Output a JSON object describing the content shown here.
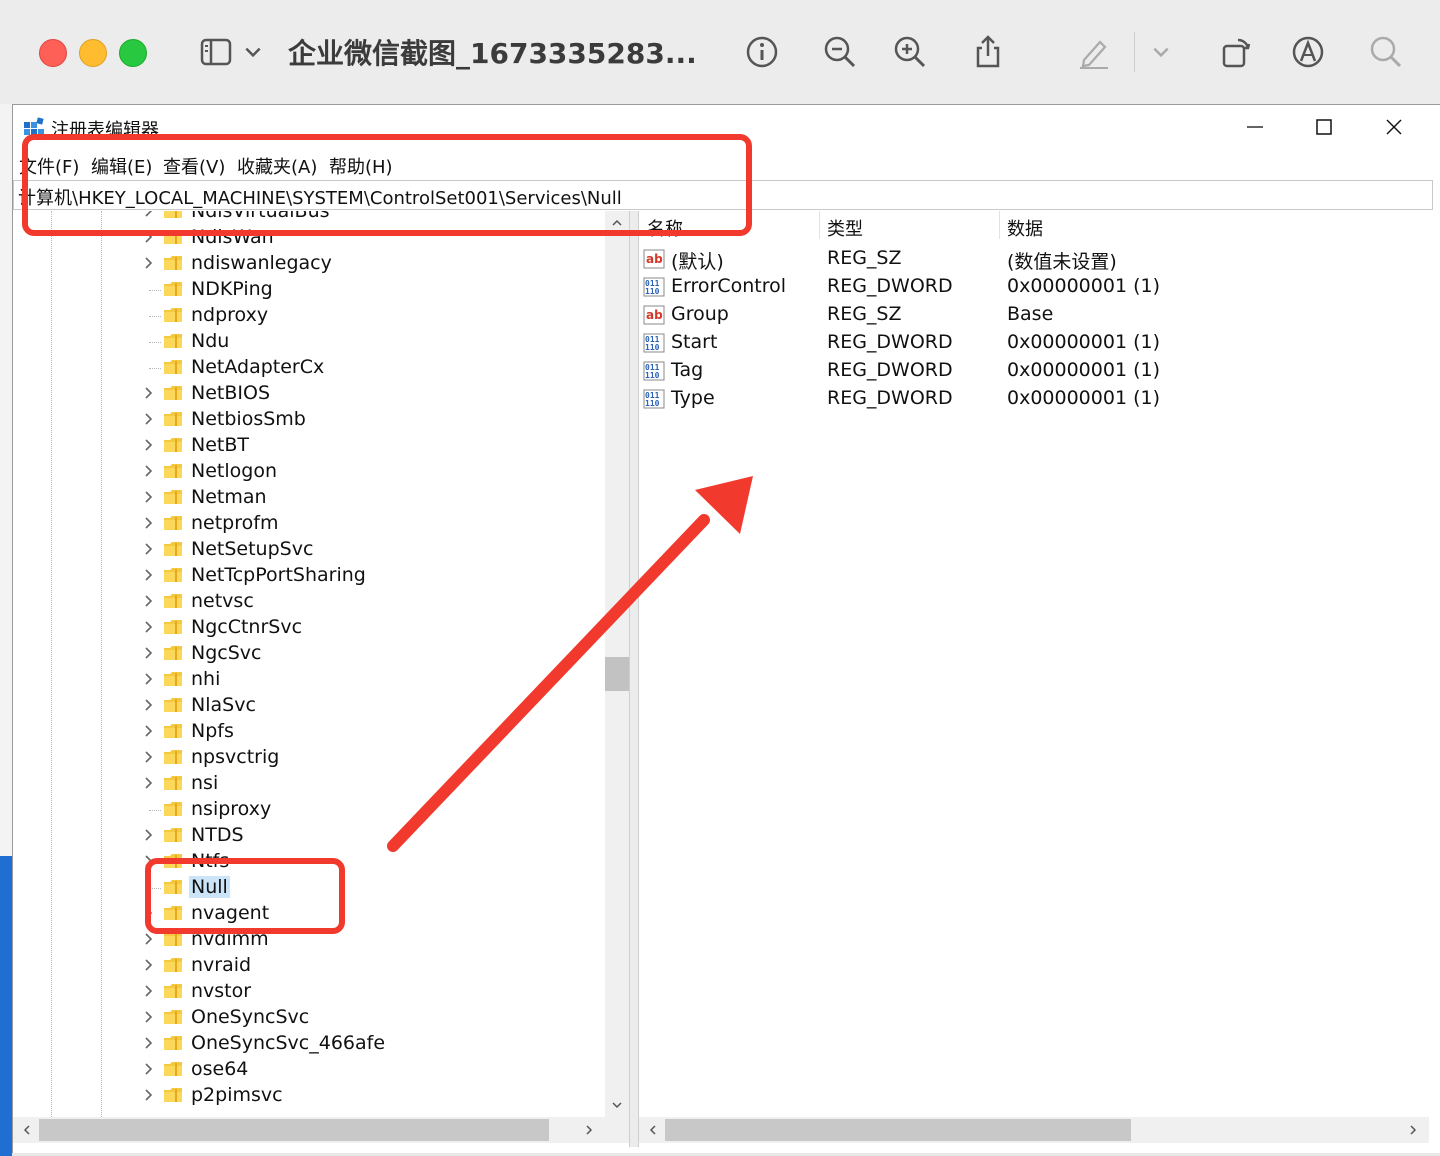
{
  "viewer": {
    "title": "企业微信截图_1673335283...",
    "toolbar_icons": [
      "sidebar-icon",
      "chevron-down-icon",
      "info-icon",
      "zoom-out-icon",
      "zoom-in-icon",
      "share-icon",
      "markup-pen-icon",
      "chevron-down-icon",
      "rotate-icon",
      "markup-icon",
      "search-icon"
    ]
  },
  "window": {
    "title": "注册表编辑器",
    "controls": [
      "minimize",
      "maximize",
      "close"
    ]
  },
  "menu": [
    {
      "label": "文件(F)"
    },
    {
      "label": "编辑(E)"
    },
    {
      "label": "查看(V)"
    },
    {
      "label": "收藏夹(A)"
    },
    {
      "label": "帮助(H)"
    }
  ],
  "address": "计算机\\HKEY_LOCAL_MACHINE\\SYSTEM\\ControlSet001\\Services\\Null",
  "tree": {
    "items": [
      {
        "label": "NdisVirtualBus",
        "expandable": true
      },
      {
        "label": "NdisWan",
        "expandable": true
      },
      {
        "label": "ndiswanlegacy",
        "expandable": true
      },
      {
        "label": "NDKPing",
        "expandable": false
      },
      {
        "label": "ndproxy",
        "expandable": false
      },
      {
        "label": "Ndu",
        "expandable": false
      },
      {
        "label": "NetAdapterCx",
        "expandable": false
      },
      {
        "label": "NetBIOS",
        "expandable": true
      },
      {
        "label": "NetbiosSmb",
        "expandable": true
      },
      {
        "label": "NetBT",
        "expandable": true
      },
      {
        "label": "Netlogon",
        "expandable": true
      },
      {
        "label": "Netman",
        "expandable": true
      },
      {
        "label": "netprofm",
        "expandable": true
      },
      {
        "label": "NetSetupSvc",
        "expandable": true
      },
      {
        "label": "NetTcpPortSharing",
        "expandable": true
      },
      {
        "label": "netvsc",
        "expandable": true
      },
      {
        "label": "NgcCtnrSvc",
        "expandable": true
      },
      {
        "label": "NgcSvc",
        "expandable": true
      },
      {
        "label": "nhi",
        "expandable": true
      },
      {
        "label": "NlaSvc",
        "expandable": true
      },
      {
        "label": "Npfs",
        "expandable": true
      },
      {
        "label": "npsvctrig",
        "expandable": true
      },
      {
        "label": "nsi",
        "expandable": true
      },
      {
        "label": "nsiproxy",
        "expandable": false
      },
      {
        "label": "NTDS",
        "expandable": true
      },
      {
        "label": "Ntfs",
        "expandable": true
      },
      {
        "label": "Null",
        "expandable": false,
        "selected": true
      },
      {
        "label": "nvagent",
        "expandable": true
      },
      {
        "label": "nvdimm",
        "expandable": true
      },
      {
        "label": "nvraid",
        "expandable": true
      },
      {
        "label": "nvstor",
        "expandable": true
      },
      {
        "label": "OneSyncSvc",
        "expandable": true
      },
      {
        "label": "OneSyncSvc_466afe",
        "expandable": true
      },
      {
        "label": "ose64",
        "expandable": true
      },
      {
        "label": "p2pimsvc",
        "expandable": true
      }
    ]
  },
  "list": {
    "columns": {
      "name": "名称",
      "type": "类型",
      "data": "数据"
    },
    "rows": [
      {
        "icon": "string-value-icon",
        "name": "(默认)",
        "type": "REG_SZ",
        "data": "(数值未设置)"
      },
      {
        "icon": "binary-value-icon",
        "name": "ErrorControl",
        "type": "REG_DWORD",
        "data": "0x00000001 (1)"
      },
      {
        "icon": "string-value-icon",
        "name": "Group",
        "type": "REG_SZ",
        "data": "Base"
      },
      {
        "icon": "binary-value-icon",
        "name": "Start",
        "type": "REG_DWORD",
        "data": "0x00000001 (1)"
      },
      {
        "icon": "binary-value-icon",
        "name": "Tag",
        "type": "REG_DWORD",
        "data": "0x00000001 (1)"
      },
      {
        "icon": "binary-value-icon",
        "name": "Type",
        "type": "REG_DWORD",
        "data": "0x00000001 (1)"
      }
    ]
  },
  "colors": {
    "annotation": "#f13a2d",
    "selection": "#cce4f7",
    "folder": "#f5c93f"
  }
}
